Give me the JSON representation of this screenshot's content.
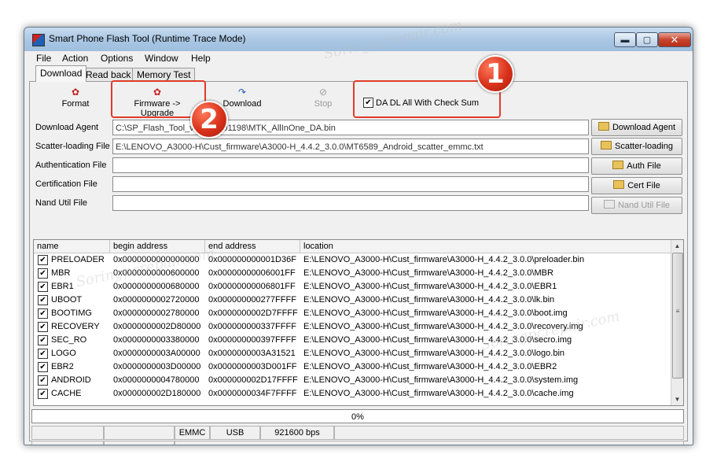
{
  "window": {
    "title": "Smart Phone Flash Tool (Runtime Trace Mode)",
    "min_glyph": "▬",
    "max_glyph": "▢",
    "close_glyph": "✕"
  },
  "menu": [
    "File",
    "Action",
    "Options",
    "Window",
    "Help"
  ],
  "tabs": [
    {
      "label": "Download",
      "active": true
    },
    {
      "label": "Read back",
      "active": false
    },
    {
      "label": "Memory Test",
      "active": false
    }
  ],
  "toolbar": {
    "format": {
      "label": "Format",
      "icon": "format-icon"
    },
    "firmware_upgrade": {
      "label": "Firmware -> Upgrade",
      "icon": "firmware-upgrade-icon"
    },
    "download": {
      "label": "Download",
      "icon": "download-arrow-icon"
    },
    "stop": {
      "label": "Stop",
      "icon": "stop-icon",
      "disabled": true
    },
    "da_checksum": {
      "label": "DA DL All With Check Sum",
      "checked": true,
      "mark": "✔"
    }
  },
  "fields": [
    {
      "label": "Download Agent",
      "value": "C:\\SP_Flash_Tool_v5.1352.01198\\MTK_AllInOne_DA.bin",
      "button": "Download Agent",
      "enabled": true
    },
    {
      "label": "Scatter-loading File",
      "value": "E:\\LENOVO_A3000-H\\Cust_firmware\\A3000-H_4.4.2_3.0.0\\MT6589_Android_scatter_emmc.txt",
      "button": "Scatter-loading",
      "enabled": true
    },
    {
      "label": "Authentication File",
      "value": "",
      "button": "Auth File",
      "enabled": true
    },
    {
      "label": "Certification File",
      "value": "",
      "button": "Cert File",
      "enabled": true
    },
    {
      "label": "Nand Util File",
      "value": "",
      "button": "Nand Util File",
      "enabled": false
    }
  ],
  "table": {
    "columns": [
      "name",
      "begin address",
      "end address",
      "location"
    ],
    "rows": [
      {
        "name": "PRELOADER",
        "begin": "0x0000000000000000",
        "end": "0x000000000001D36F",
        "location": "E:\\LENOVO_A3000-H\\Cust_firmware\\A3000-H_4.4.2_3.0.0\\preloader.bin",
        "checked": true
      },
      {
        "name": "MBR",
        "begin": "0x0000000000600000",
        "end": "0x00000000006001FF",
        "location": "E:\\LENOVO_A3000-H\\Cust_firmware\\A3000-H_4.4.2_3.0.0\\MBR",
        "checked": true
      },
      {
        "name": "EBR1",
        "begin": "0x0000000000680000",
        "end": "0x00000000006801FF",
        "location": "E:\\LENOVO_A3000-H\\Cust_firmware\\A3000-H_4.4.2_3.0.0\\EBR1",
        "checked": true
      },
      {
        "name": "UBOOT",
        "begin": "0x0000000002720000",
        "end": "0x000000000277FFFF",
        "location": "E:\\LENOVO_A3000-H\\Cust_firmware\\A3000-H_4.4.2_3.0.0\\lk.bin",
        "checked": true
      },
      {
        "name": "BOOTIMG",
        "begin": "0x0000000002780000",
        "end": "0x0000000002D7FFFF",
        "location": "E:\\LENOVO_A3000-H\\Cust_firmware\\A3000-H_4.4.2_3.0.0\\boot.img",
        "checked": true
      },
      {
        "name": "RECOVERY",
        "begin": "0x0000000002D80000",
        "end": "0x000000000337FFFF",
        "location": "E:\\LENOVO_A3000-H\\Cust_firmware\\A3000-H_4.4.2_3.0.0\\recovery.img",
        "checked": true
      },
      {
        "name": "SEC_RO",
        "begin": "0x0000000003380000",
        "end": "0x000000000397FFFF",
        "location": "E:\\LENOVO_A3000-H\\Cust_firmware\\A3000-H_4.4.2_3.0.0\\secro.img",
        "checked": true
      },
      {
        "name": "LOGO",
        "begin": "0x0000000003A00000",
        "end": "0x0000000003A31521",
        "location": "E:\\LENOVO_A3000-H\\Cust_firmware\\A3000-H_4.4.2_3.0.0\\logo.bin",
        "checked": true
      },
      {
        "name": "EBR2",
        "begin": "0x0000000003D00000",
        "end": "0x0000000003D001FF",
        "location": "E:\\LENOVO_A3000-H\\Cust_firmware\\A3000-H_4.4.2_3.0.0\\EBR2",
        "checked": true
      },
      {
        "name": "ANDROID",
        "begin": "0x0000000004780000",
        "end": "0x000000002D17FFFF",
        "location": "E:\\LENOVO_A3000-H\\Cust_firmware\\A3000-H_4.4.2_3.0.0\\system.img",
        "checked": true
      },
      {
        "name": "CACHE",
        "begin": "0x000000002D180000",
        "end": "0x0000000034F7FFFF",
        "location": "E:\\LENOVO_A3000-H\\Cust_firmware\\A3000-H_4.4.2_3.0.0\\cache.img",
        "checked": true
      }
    ],
    "check_mark": "✔"
  },
  "scrollbar": {
    "up": "▲",
    "down": "▼",
    "grip": "≡"
  },
  "progress": {
    "text": "0%",
    "fraction": 0
  },
  "status": {
    "type": "EMMC",
    "port": "USB",
    "baud": "921600 bps"
  },
  "annotations": {
    "badge1": "1",
    "badge2": "2",
    "color": "#e13a2a"
  },
  "watermark": "Soringpcrepair.com"
}
